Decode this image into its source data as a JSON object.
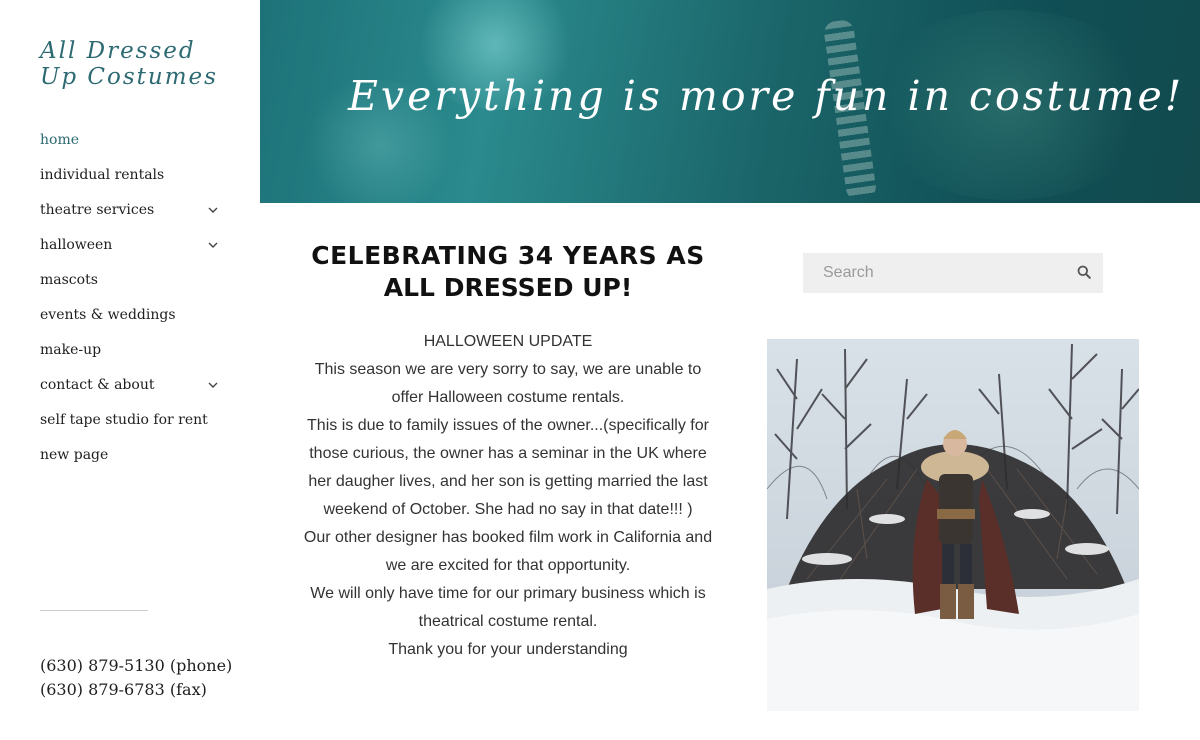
{
  "site": {
    "logo_line1": "All Dressed",
    "logo_line2": "Up Costumes"
  },
  "nav": {
    "items": [
      {
        "label": "home",
        "active": true,
        "has_submenu": false
      },
      {
        "label": "individual rentals",
        "active": false,
        "has_submenu": false
      },
      {
        "label": "theatre services",
        "active": false,
        "has_submenu": true
      },
      {
        "label": "halloween",
        "active": false,
        "has_submenu": true
      },
      {
        "label": "mascots",
        "active": false,
        "has_submenu": false
      },
      {
        "label": "events & weddings",
        "active": false,
        "has_submenu": false
      },
      {
        "label": "make-up",
        "active": false,
        "has_submenu": false
      },
      {
        "label": "contact & about",
        "active": false,
        "has_submenu": true
      },
      {
        "label": "self tape studio for rent",
        "active": false,
        "has_submenu": false
      },
      {
        "label": "new page",
        "active": false,
        "has_submenu": false
      }
    ]
  },
  "contact": {
    "phone": "(630) 879-5130 (phone)",
    "fax": "(630) 879-6783 (fax)"
  },
  "banner": {
    "tagline": "Everything is more fun in costume!"
  },
  "main": {
    "heading_line1": "CELEBRATING 34 YEARS AS",
    "heading_line2": "ALL DRESSED UP!",
    "paragraphs": [
      "HALLOWEEN UPDATE",
      "This season we are very sorry to say, we are unable to offer Halloween costume rentals.",
      "This is due to family issues of the owner...(specifically for those curious, the owner has a seminar in the UK where her daugher lives, and her son is getting married the last weekend of October. She had no say in that date!!!  )",
      " Our other designer has booked film work in California and we are excited for that opportunity.",
      "We will only have time for our primary business which is theatrical costume rental.",
      "Thank you for your understanding"
    ]
  },
  "search": {
    "placeholder": "Search",
    "icon": "search-icon"
  },
  "colors": {
    "accent": "#2d6a72",
    "banner_teal": "#1d7278",
    "search_bg": "#efefef"
  }
}
